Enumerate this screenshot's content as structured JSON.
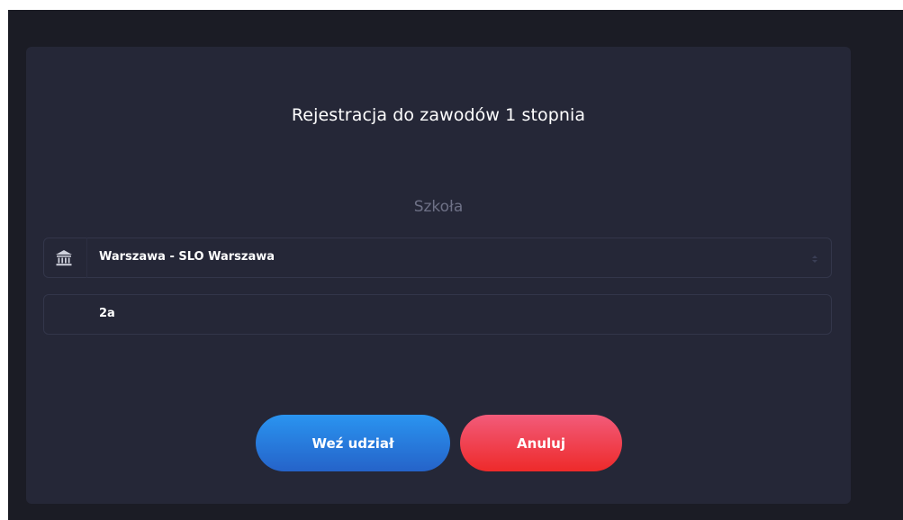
{
  "modal": {
    "title": "Rejestracja do zawodów 1 stopnia",
    "section_label": "Szkoła"
  },
  "school_select": {
    "icon": "institution-icon",
    "value": "Warszawa - SLO Warszawa"
  },
  "class_field": {
    "value": "2a"
  },
  "buttons": {
    "submit_label": "Weź udział",
    "cancel_label": "Anuluj"
  },
  "colors": {
    "background": "#1b1c25",
    "modal": "#252737",
    "primary": "#2a7fe0",
    "danger": "#f03e4e"
  }
}
